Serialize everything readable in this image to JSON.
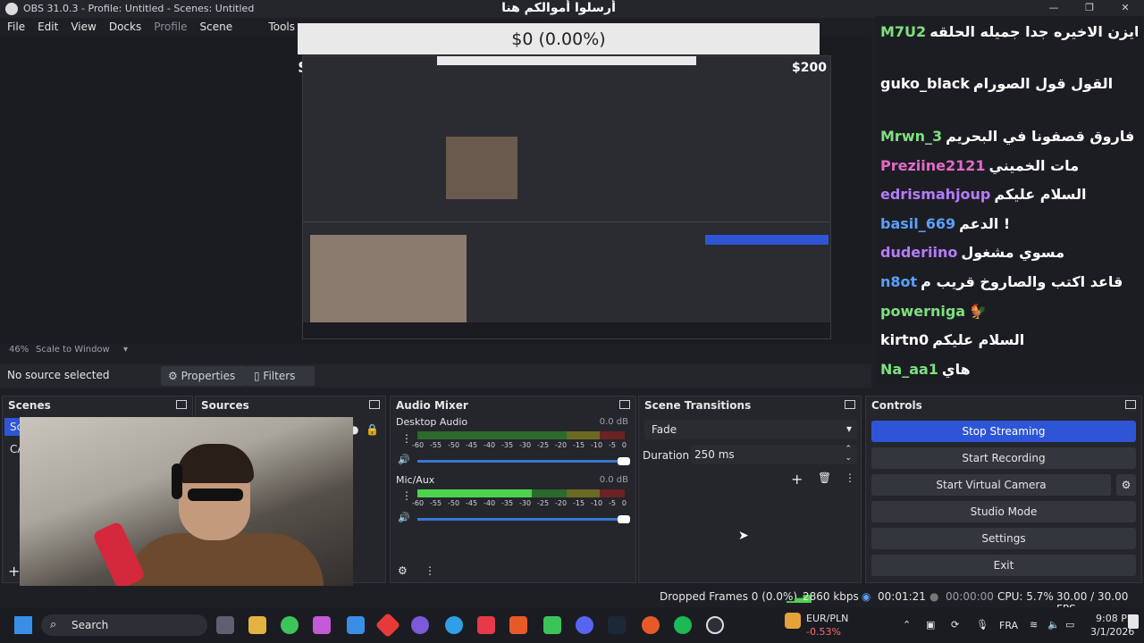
{
  "window": {
    "title": "OBS 31.0.3 - Profile: Untitled - Scenes: Untitled"
  },
  "menu": [
    "File",
    "Edit",
    "View",
    "Docks",
    "Profile",
    "Scene Collection",
    "Tools"
  ],
  "preview": {
    "banner_title": "أرسلوا أموالكم هنا",
    "banner_amount": "$0 (0.00%)",
    "money_left": "$0",
    "money_right": "$200",
    "zoom": "46%",
    "zoom_mode": "Scale to Window"
  },
  "chat": [
    {
      "user": "M7U2",
      "color": "#7ee07e",
      "msg": "يا فاروق ما نبي بث سياسي تابع حلقة جوجيتسو كايزن الاخيره جدا جميله الحلقه"
    },
    {
      "user": "guko_black",
      "color": "#ffffff",
      "msg": "القول قول الصورام"
    },
    {
      "user": "Mrwn_3",
      "color": "#7ee07e",
      "msg": "فاروق قصفونا في البحريم"
    },
    {
      "user": "Preziine2121",
      "color": "#e26acb",
      "msg": "مات الخميني"
    },
    {
      "user": "edrismahjoup",
      "color": "#b57cff",
      "msg": "السلام عليكم"
    },
    {
      "user": "basil_669",
      "color": "#5aa0ff",
      "msg": "الدعم !"
    },
    {
      "user": "duderiino",
      "color": "#b57cff",
      "msg": "مسوي مشغول"
    },
    {
      "user": "n8ot",
      "color": "#5aa0ff",
      "msg": "قاعد اكتب والصاروخ قريب م"
    },
    {
      "user": "powerniga",
      "color": "#7ee07e",
      "msg": "🐓"
    },
    {
      "user": "kirtn0",
      "color": "#ffffff",
      "msg": "السلام عليكم"
    },
    {
      "user": "Na_aa1",
      "color": "#7ee07e",
      "msg": "هاي"
    }
  ],
  "source_bar": {
    "no_source": "No source selected",
    "properties": "Properties",
    "filters": "Filters"
  },
  "docks": {
    "scenes": {
      "title": "Scenes",
      "items": [
        "Sce",
        "CA"
      ]
    },
    "sources": {
      "title": "Sources"
    },
    "audio_mixer": {
      "title": "Audio Mixer",
      "channels": [
        {
          "name": "Desktop Audio",
          "db": "0.0 dB",
          "level": 0.0
        },
        {
          "name": "Mic/Aux",
          "db": "0.0 dB",
          "level": 0.55
        }
      ],
      "ticks": [
        "-60",
        "-55",
        "-50",
        "-45",
        "-40",
        "-35",
        "-30",
        "-25",
        "-20",
        "-15",
        "-10",
        "-5",
        "0"
      ]
    },
    "transitions": {
      "title": "Scene Transitions",
      "selected": "Fade",
      "duration_label": "Duration",
      "duration_value": "250 ms"
    },
    "controls": {
      "title": "Controls",
      "stop_streaming": "Stop Streaming",
      "start_recording": "Start Recording",
      "start_virtual_camera": "Start Virtual Camera",
      "studio_mode": "Studio Mode",
      "settings": "Settings",
      "exit": "Exit"
    }
  },
  "status": {
    "dropped": "Dropped Frames 0 (0.0%)",
    "kbps": "2860 kbps",
    "stream_time": "00:01:21",
    "rec_time": "00:00:00",
    "cpu": "CPU: 5.7%",
    "fps": "30.00 / 30.00 FPS"
  },
  "taskbar": {
    "search": "Search",
    "ticker_name": "EUR/PLN",
    "ticker_change": "-0.53%",
    "lang": "FRA",
    "time": "9:08 PM",
    "date": "3/1/2026"
  }
}
